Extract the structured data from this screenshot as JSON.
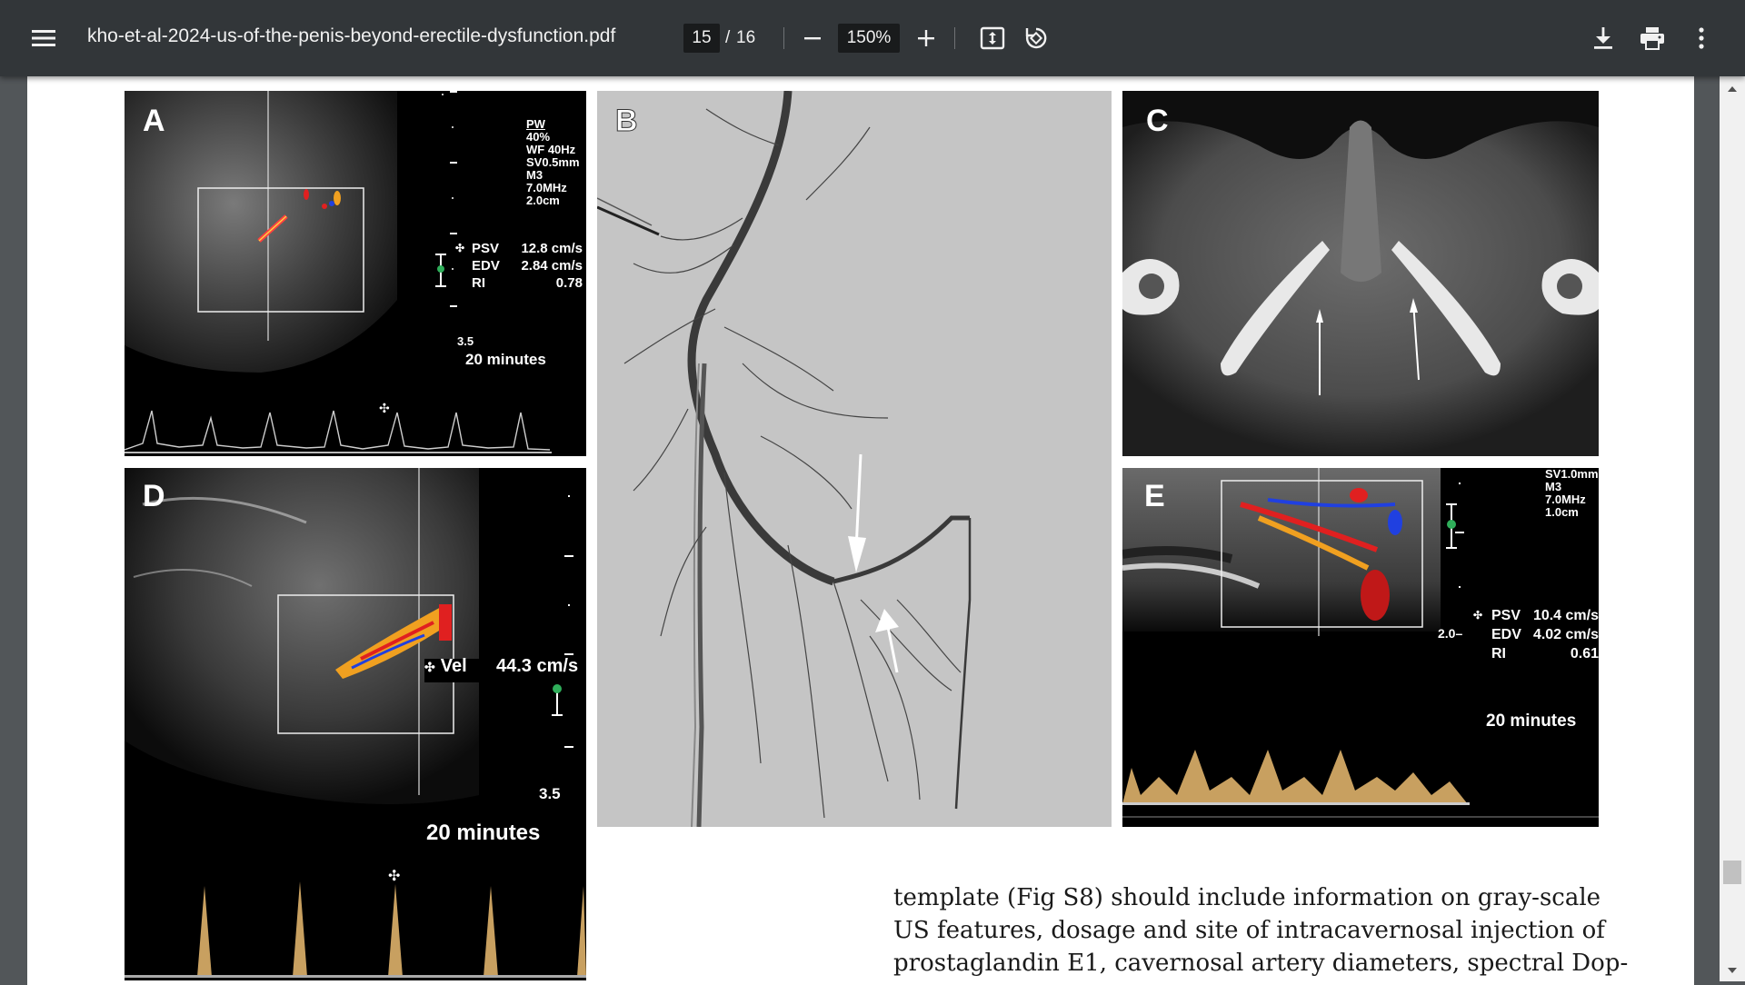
{
  "toolbar": {
    "menu_icon": "hamburger-icon",
    "title": "kho-et-al-2024-us-of-the-penis-beyond-erectile-dysfunction.pdf",
    "page_current": "15",
    "page_separator": "/",
    "page_total": "16",
    "zoom": "150%",
    "icons": [
      "minus-icon",
      "plus-icon",
      "fit-page-icon",
      "rotate-icon",
      "download-icon",
      "print-icon",
      "more-vert-icon"
    ]
  },
  "figure": {
    "panel_a": {
      "letter": "A",
      "pw": "PW",
      "params": [
        "40%",
        "WF  40Hz",
        "SV0.5mm",
        "M3",
        "7.0MHz",
        "2.0cm"
      ],
      "psv_label": "PSV",
      "psv_value": "12.8 cm/s",
      "edv_label": "EDV",
      "edv_value": "2.84 cm/s",
      "ri_label": "RI",
      "ri_value": "0.78",
      "depth": "3.5",
      "time": "20 minutes"
    },
    "panel_b": {
      "letter": "B"
    },
    "panel_c": {
      "letter": "C"
    },
    "panel_d": {
      "letter": "D",
      "vel_label": "Vel",
      "vel_value": "44.3 cm/s",
      "depth": "3.5",
      "time": "20 minutes"
    },
    "panel_e": {
      "letter": "E",
      "params": [
        "SV1.0mm",
        "M3",
        "7.0MHz",
        "1.0cm"
      ],
      "psv_label": "PSV",
      "psv_value": "10.4 cm/s",
      "edv_label": "EDV",
      "edv_value": "4.02 cm/s",
      "ri_label": "RI",
      "ri_value": "0.61",
      "depth": "2.0",
      "time": "20 minutes"
    }
  },
  "body_text": {
    "lines": [
      "template (Fig S8) should include information on gray-scale",
      "US features, dosage and site of intracavernosal injection of",
      "prostaglandin E1, cavernosal artery diameters, spectral Dop-"
    ]
  },
  "colors": {
    "toolbar": "#323639",
    "viewer_bg": "#525659",
    "doppler_red": "#e02020",
    "doppler_blue": "#2040e0",
    "doppler_orange": "#f0a020",
    "marker_green": "#2fae5a"
  }
}
